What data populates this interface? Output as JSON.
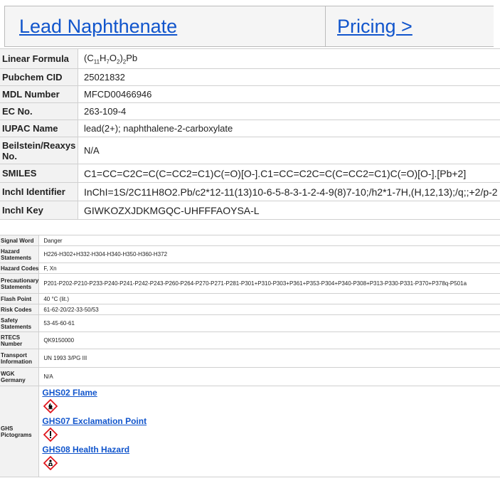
{
  "header": {
    "title": "Lead Naphthenate",
    "pricing": "Pricing >"
  },
  "properties": [
    {
      "label": "Linear Formula",
      "value": "(C11H7O2)2Pb"
    },
    {
      "label": "Pubchem CID",
      "value": "25021832"
    },
    {
      "label": "MDL Number",
      "value": "MFCD00466946"
    },
    {
      "label": "EC No.",
      "value": "263-109-4"
    },
    {
      "label": "IUPAC Name",
      "value": "lead(2+); naphthalene-2-carboxylate"
    },
    {
      "label": "Beilstein/Reaxys No.",
      "value": "N/A"
    },
    {
      "label": "SMILES",
      "value": "C1=CC=C2C=C(C=CC2=C1)C(=O)[O-].C1=CC=C2C=C(C=CC2=C1)C(=O)[O-].[Pb+2]"
    },
    {
      "label": "InchI Identifier",
      "value": "InChI=1S/2C11H8O2.Pb/c2*12-11(13)10-6-5-8-3-1-2-4-9(8)7-10;/h2*1-7H,(H,12,13);/q;;+2/p-2"
    },
    {
      "label": "InchI Key",
      "value": "GIWKOZXJDKMGQC-UHFFFAOYSA-L"
    }
  ],
  "safety": [
    {
      "label": "Signal Word",
      "value": "Danger"
    },
    {
      "label": "Hazard Statements",
      "value": "H226-H302+H332-H304-H340-H350-H360-H372"
    },
    {
      "label": "Hazard Codes",
      "value": "F, Xn"
    },
    {
      "label": "Precautionary Statements",
      "value": "P201-P202-P210-P233-P240-P241-P242-P243-P260-P264-P270-P271-P281-P301+P310-P303+P361+P353-P304+P340-P308+P313-P330-P331-P370+P378q-P501a"
    },
    {
      "label": "Flash Point",
      "value": "40 °C (lit.)"
    },
    {
      "label": "Risk Codes",
      "value": "61-62-20/22-33-50/53"
    },
    {
      "label": "Safety Statements",
      "value": "53-45-60-61"
    },
    {
      "label": "RTECS Number",
      "value": "QK9150000"
    },
    {
      "label": "Transport Information",
      "value": "UN 1993 3/PG III"
    },
    {
      "label": "WGK Germany",
      "value": "N/A"
    }
  ],
  "pictograms": {
    "label": "GHS Pictograms",
    "items": [
      "GHS02 Flame",
      "GHS07 Exclamation Point",
      "GHS08 Health Hazard"
    ]
  },
  "colors": {
    "link": "#1155cc",
    "ghs_red": "#e0161d"
  }
}
